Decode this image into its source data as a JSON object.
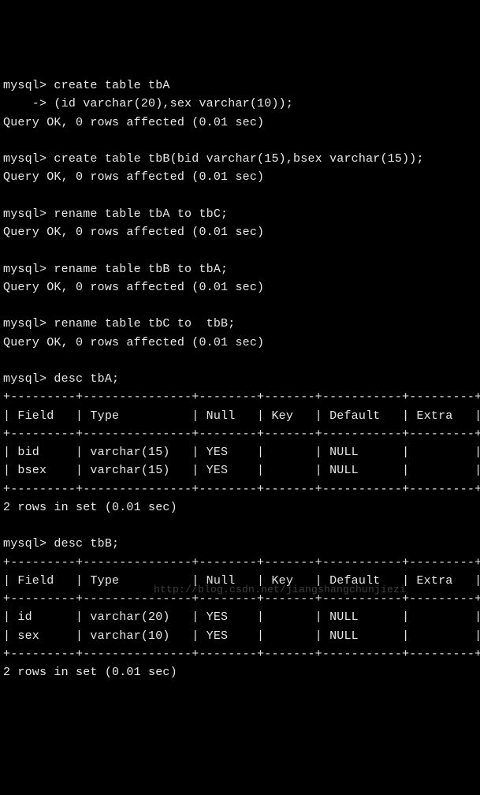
{
  "prompt": "mysql>",
  "cont": "    ->",
  "commands": [
    {
      "lines": [
        "create table tbA",
        "(id varchar(20),sex varchar(10));"
      ],
      "result": "Query OK, 0 rows affected (0.01 sec)"
    },
    {
      "lines": [
        "create table tbB(bid varchar(15),bsex varchar(15));"
      ],
      "result": "Query OK, 0 rows affected (0.01 sec)"
    },
    {
      "lines": [
        "rename table tbA to tbC;"
      ],
      "result": "Query OK, 0 rows affected (0.01 sec)"
    },
    {
      "lines": [
        "rename table tbB to tbA;"
      ],
      "result": "Query OK, 0 rows affected (0.01 sec)"
    },
    {
      "lines": [
        "rename table tbC to  tbB;"
      ],
      "result": "Query OK, 0 rows affected (0.01 sec)"
    }
  ],
  "descA": {
    "cmd": "desc tbA;",
    "headers": [
      "Field",
      "Type",
      "Null",
      "Key",
      "Default",
      "Extra"
    ],
    "rows": [
      {
        "Field": "bid",
        "Type": "varchar(15)",
        "Null": "YES",
        "Key": "",
        "Default": "NULL",
        "Extra": ""
      },
      {
        "Field": "bsex",
        "Type": "varchar(15)",
        "Null": "YES",
        "Key": "",
        "Default": "NULL",
        "Extra": ""
      }
    ],
    "footer": "2 rows in set (0.01 sec)"
  },
  "descB": {
    "cmd": "desc tbB;",
    "headers": [
      "Field",
      "Type",
      "Null",
      "Key",
      "Default",
      "Extra"
    ],
    "rows": [
      {
        "Field": "id",
        "Type": "varchar(20)",
        "Null": "YES",
        "Key": "",
        "Default": "NULL",
        "Extra": ""
      },
      {
        "Field": "sex",
        "Type": "varchar(10)",
        "Null": "YES",
        "Key": "",
        "Default": "NULL",
        "Extra": ""
      }
    ],
    "footer": "2 rows in set (0.01 sec)"
  },
  "widths": {
    "Field": 7,
    "Type": 13,
    "Null": 6,
    "Key": 5,
    "Default": 9,
    "Extra": 7
  },
  "watermark": "http://blog.csdn.net/jiangshangchunjiezi"
}
